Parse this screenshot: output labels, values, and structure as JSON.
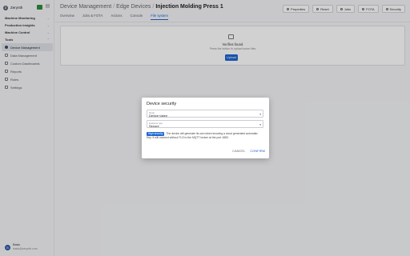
{
  "sidebar": {
    "brand": "Zerynth",
    "groups": [
      {
        "label": "Machine Monitoring"
      },
      {
        "label": "Production Insights"
      },
      {
        "label": "Machine Control"
      },
      {
        "label": "Tools"
      }
    ],
    "items": [
      {
        "label": "Device Management",
        "icon": "devices-icon",
        "active": true
      },
      {
        "label": "Data Management",
        "icon": "database-icon"
      },
      {
        "label": "Custom Dashboards",
        "icon": "dashboard-icon"
      },
      {
        "label": "Reports",
        "icon": "report-icon"
      },
      {
        "label": "Rules",
        "icon": "rules-icon"
      },
      {
        "label": "Settings",
        "icon": "gear-icon"
      }
    ],
    "user": {
      "initial": "B",
      "name": "Basic",
      "email": "basic@zerynth.com"
    }
  },
  "header": {
    "breadcrumb": [
      "Device Management",
      "Edge Devices",
      "Injection Molding Press 1"
    ],
    "actions": [
      "Properties",
      "Reset",
      "Jobs",
      "FOTA",
      "Security"
    ],
    "tabs": [
      "Overview",
      "Jobs & FOTA",
      "Actions",
      "Console",
      "File system"
    ],
    "active_tab": "File system"
  },
  "main": {
    "empty_title": "No files found",
    "empty_subtitle": "Press the button to upload some files",
    "upload_label": "Upload"
  },
  "dialog": {
    "title": "Device security",
    "field1": {
      "label": "Mode",
      "value": "Device token"
    },
    "field2": {
      "label": "Endpoint type",
      "value": "Secure"
    },
    "badge": "High security",
    "info": "The device will generate its own token knowing a cloud generated automatic Key. It will connect without TLS to the MQTT broker at the port 1883.",
    "cancel": "CANCEL",
    "confirm": "CONFIRM"
  },
  "colors": {
    "accent": "#1f66d1",
    "brand": "#2e8b3e"
  }
}
